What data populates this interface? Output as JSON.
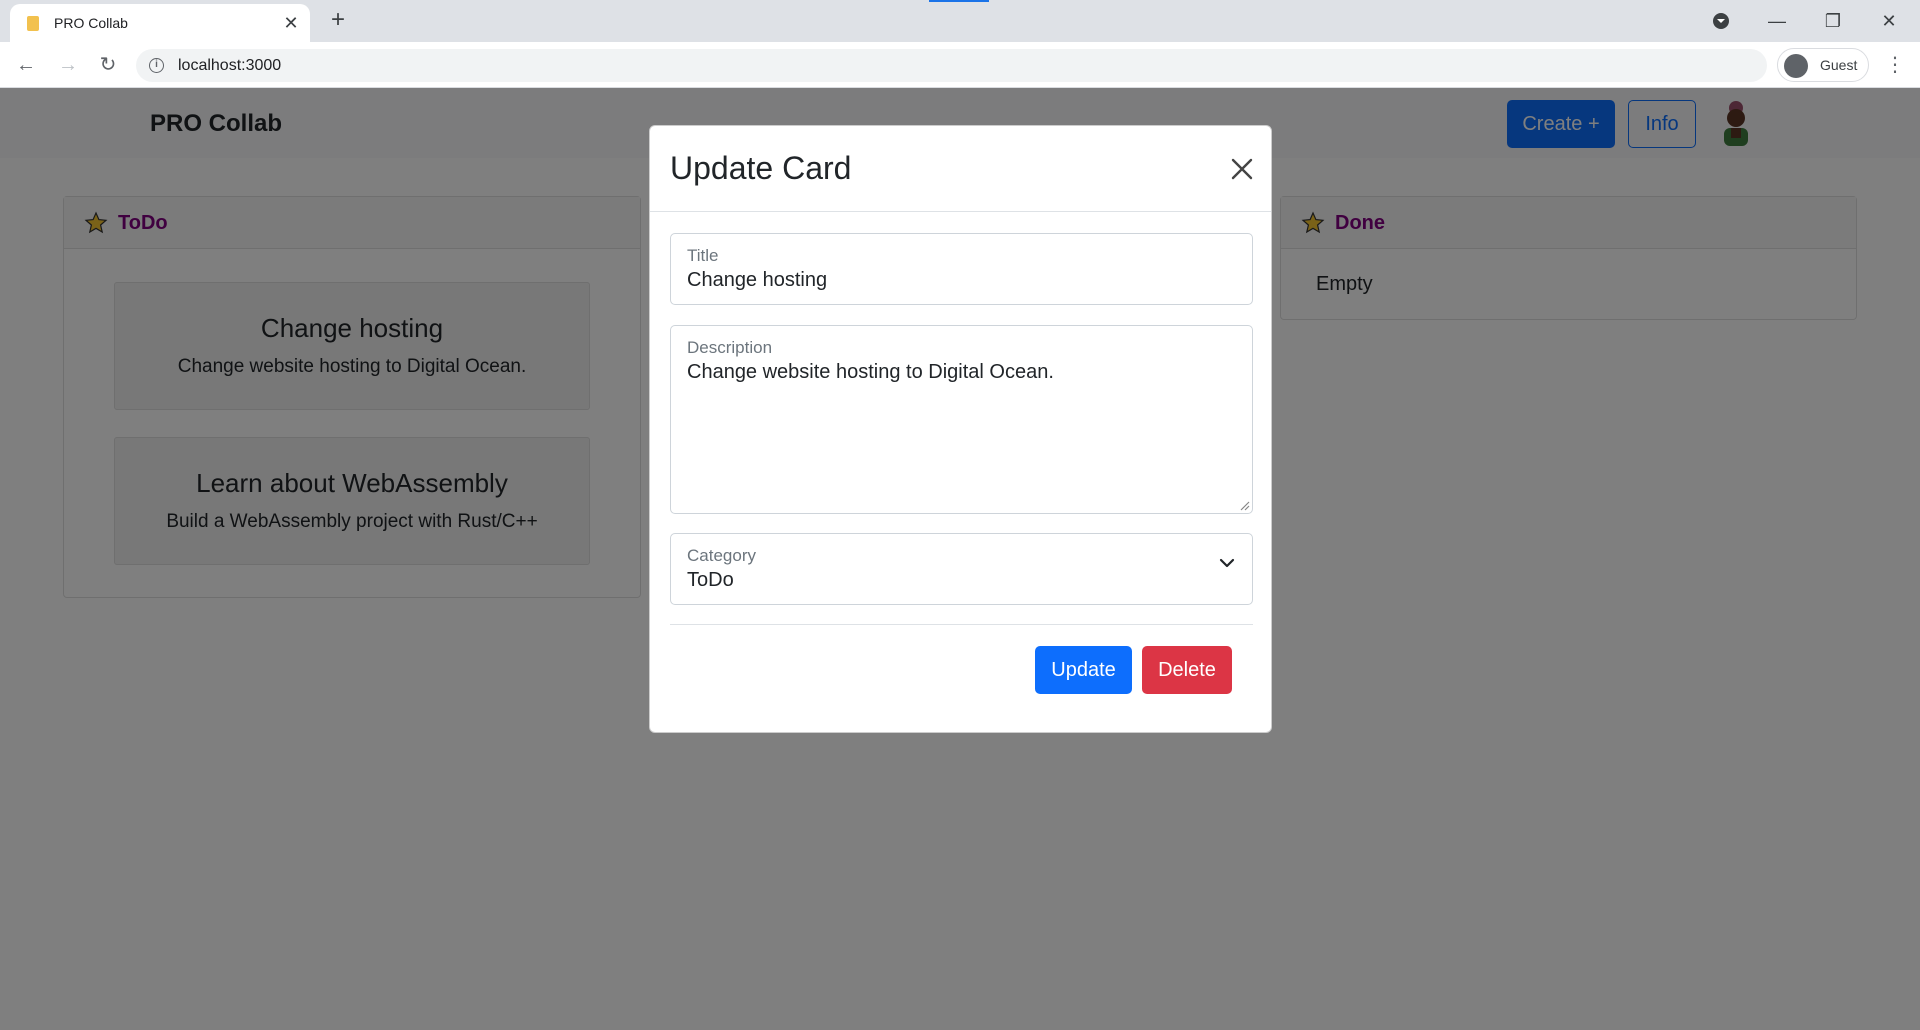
{
  "browser": {
    "tab_title": "PRO Collab",
    "url": "localhost:3000",
    "profile": "Guest"
  },
  "app": {
    "brand": "PRO Collab",
    "create_label": "Create +",
    "info_label": "Info"
  },
  "columns": [
    {
      "title": "ToDo",
      "cards": [
        {
          "title": "Change hosting",
          "text": "Change website hosting to Digital Ocean."
        },
        {
          "title": "Learn about WebAssembly",
          "text": "Build a WebAssembly project with Rust/C++"
        }
      ]
    },
    {
      "title": "Done",
      "empty_text": "Empty"
    }
  ],
  "modal": {
    "title": "Update Card",
    "title_label": "Title",
    "title_value": "Change hosting",
    "description_label": "Description",
    "description_value": "Change website hosting to Digital Ocean.",
    "category_label": "Category",
    "category_value": "ToDo",
    "update_label": "Update",
    "delete_label": "Delete"
  },
  "colors": {
    "primary": "#0d6efd",
    "danger": "#dc3545",
    "column_title": "#800080",
    "star": "#f4c430"
  }
}
